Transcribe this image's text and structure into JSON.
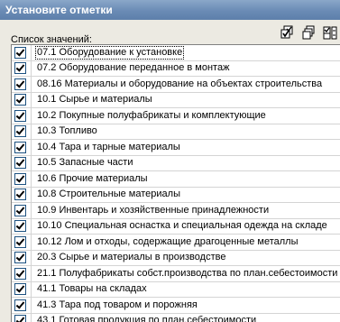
{
  "window": {
    "title": "Установите отметки"
  },
  "list_label": "Список значений:",
  "toolbar": {
    "buttons": [
      {
        "icon": "check-all-icon"
      },
      {
        "icon": "uncheck-all-icon"
      },
      {
        "icon": "invert-selection-icon"
      }
    ]
  },
  "items": [
    {
      "label": "07.1 Оборудование к установке",
      "checked": true,
      "selected": true
    },
    {
      "label": "07.2 Оборудование переданное в монтаж",
      "checked": true
    },
    {
      "label": "08.16 Материалы и оборудование на объектах строительства",
      "checked": true
    },
    {
      "label": "10.1 Сырье и материалы",
      "checked": true
    },
    {
      "label": "10.2 Покупные полуфабрикаты и комплектующие",
      "checked": true
    },
    {
      "label": "10.3 Топливо",
      "checked": true
    },
    {
      "label": "10.4 Тара и тарные материалы",
      "checked": true
    },
    {
      "label": "10.5 Запасные части",
      "checked": true
    },
    {
      "label": "10.6 Прочие материалы",
      "checked": true
    },
    {
      "label": "10.8 Строительные материалы",
      "checked": true
    },
    {
      "label": "10.9 Инвентарь и хозяйственные принадлежности",
      "checked": true
    },
    {
      "label": "10.10 Специальная оснастка и специальная одежда на складе",
      "checked": true
    },
    {
      "label": "10.12 Лом и отходы, содержащие драгоценные металлы",
      "checked": true
    },
    {
      "label": "20.3 Сырье и материалы в производстве",
      "checked": true
    },
    {
      "label": "21.1 Полуфабрикаты собст.производства по план.себестоимости",
      "checked": true
    },
    {
      "label": "41.1 Товары на складах",
      "checked": true
    },
    {
      "label": "41.3 Тара под товаром и порожняя",
      "checked": true
    },
    {
      "label": "43.1 Готовая продукция по план.себестоимости",
      "checked": true
    }
  ]
}
